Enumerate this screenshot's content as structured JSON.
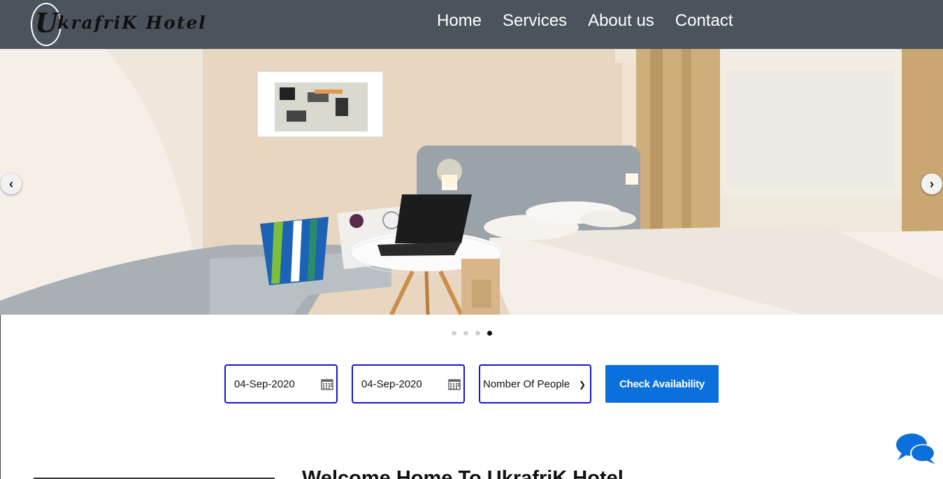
{
  "brand": {
    "logo_mark": "U",
    "logo_text": "krafriK Hotel"
  },
  "nav": {
    "items": [
      "Home",
      "Services",
      "About us",
      "Contact"
    ]
  },
  "carousel": {
    "prev_icon": "chevron-left-icon",
    "next_icon": "chevron-right-icon",
    "slide_count": 4,
    "active_slide": 4
  },
  "booking": {
    "checkin_value": "04-Sep-2020",
    "checkout_value": "04-Sep-2020",
    "people_selected": "Nomber Of People",
    "button_label": "Check Availability",
    "border_color": "#1a14c8",
    "button_color": "#0b6fdc"
  },
  "main": {
    "welcome_heading": "Welcome Home To UkrafriK Hotel"
  },
  "chat": {
    "icon": "chat-bubbles-icon",
    "color": "#0b6fdc"
  },
  "colors": {
    "header_bg": "#4b545c"
  }
}
